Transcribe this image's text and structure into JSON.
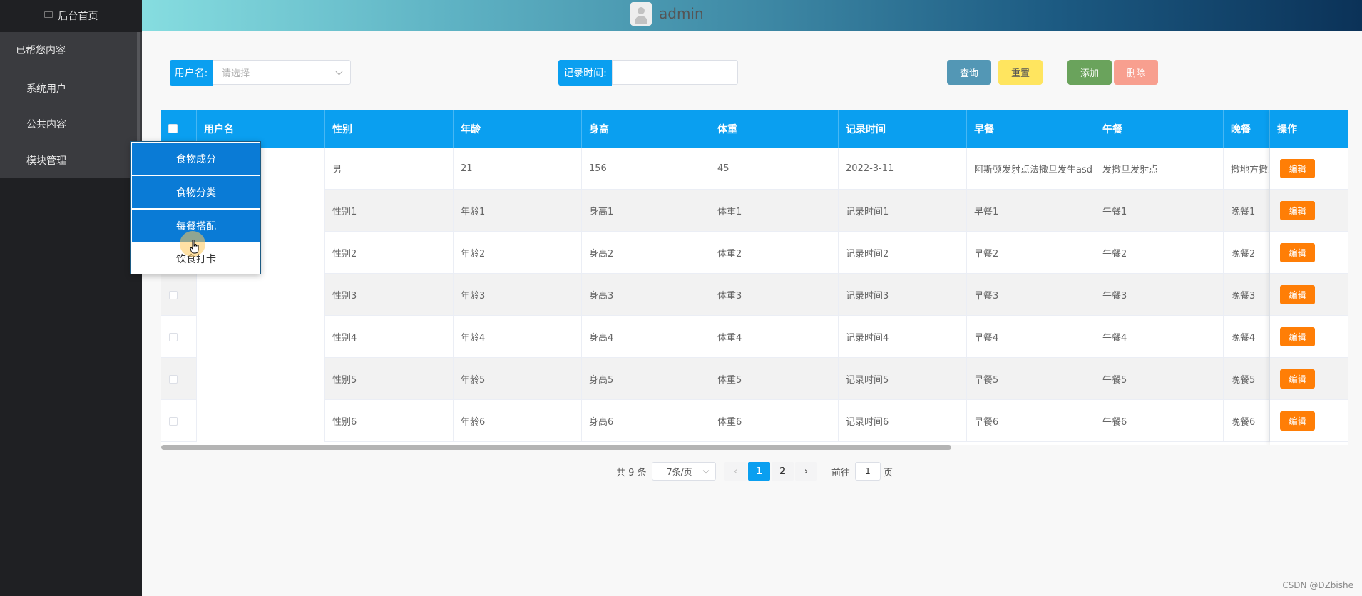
{
  "sidebar": {
    "home": "后台首页",
    "root_label": "已帮您内容",
    "items": [
      {
        "label": "系统用户"
      },
      {
        "label": "公共内容"
      },
      {
        "label": "模块管理"
      }
    ]
  },
  "header": {
    "username": "admin"
  },
  "search": {
    "username_label": "用户名:",
    "username_placeholder": "请选择",
    "time_label": "记录时间:",
    "buttons": {
      "query": "查询",
      "reset": "重置",
      "add": "添加",
      "delete": "删除"
    }
  },
  "table": {
    "columns": [
      "用户名",
      "性别",
      "年龄",
      "身高",
      "体重",
      "记录时间",
      "早餐",
      "午餐",
      "晚餐",
      "操作"
    ],
    "rows": [
      {
        "gender": "男",
        "age": "21",
        "height": "156",
        "weight": "45",
        "time": "2022-3-11",
        "breakfast": "阿斯顿发射点法撒旦发生asd",
        "lunch": "发撒旦发射点",
        "dinner": "撒地方撒旦"
      },
      {
        "gender": "性别1",
        "age": "年龄1",
        "height": "身高1",
        "weight": "体重1",
        "time": "记录时间1",
        "breakfast": "早餐1",
        "lunch": "午餐1",
        "dinner": "晚餐1"
      },
      {
        "gender": "性别2",
        "age": "年龄2",
        "height": "身高2",
        "weight": "体重2",
        "time": "记录时间2",
        "breakfast": "早餐2",
        "lunch": "午餐2",
        "dinner": "晚餐2"
      },
      {
        "gender": "性别3",
        "age": "年龄3",
        "height": "身高3",
        "weight": "体重3",
        "time": "记录时间3",
        "breakfast": "早餐3",
        "lunch": "午餐3",
        "dinner": "晚餐3"
      },
      {
        "gender": "性别4",
        "age": "年龄4",
        "height": "身高4",
        "weight": "体重4",
        "time": "记录时间4",
        "breakfast": "早餐4",
        "lunch": "午餐4",
        "dinner": "晚餐4"
      },
      {
        "gender": "性别5",
        "age": "年龄5",
        "height": "身高5",
        "weight": "体重5",
        "time": "记录时间5",
        "breakfast": "早餐5",
        "lunch": "午餐5",
        "dinner": "晚餐5"
      },
      {
        "gender": "性别6",
        "age": "年龄6",
        "height": "身高6",
        "weight": "体重6",
        "time": "记录时间6",
        "breakfast": "早餐6",
        "lunch": "午餐6",
        "dinner": "晚餐6"
      }
    ],
    "edit_label": "编辑"
  },
  "pagination": {
    "total": "共 9 条",
    "page_size": "7条/页",
    "pages": [
      "1",
      "2"
    ],
    "goto_label": "前往",
    "goto_value": "1",
    "page_unit": "页"
  },
  "dropdown": {
    "items": [
      "食物成分",
      "食物分类",
      "每餐搭配",
      "饮食打卡"
    ]
  },
  "watermark": "CSDN @DZbishe",
  "colors": {
    "primary": "#0a9ff0",
    "query": "#5397b5",
    "reset": "#ffe55f",
    "add": "#6aa35c",
    "delete": "#f89f8f",
    "edit": "#ff7e06"
  }
}
